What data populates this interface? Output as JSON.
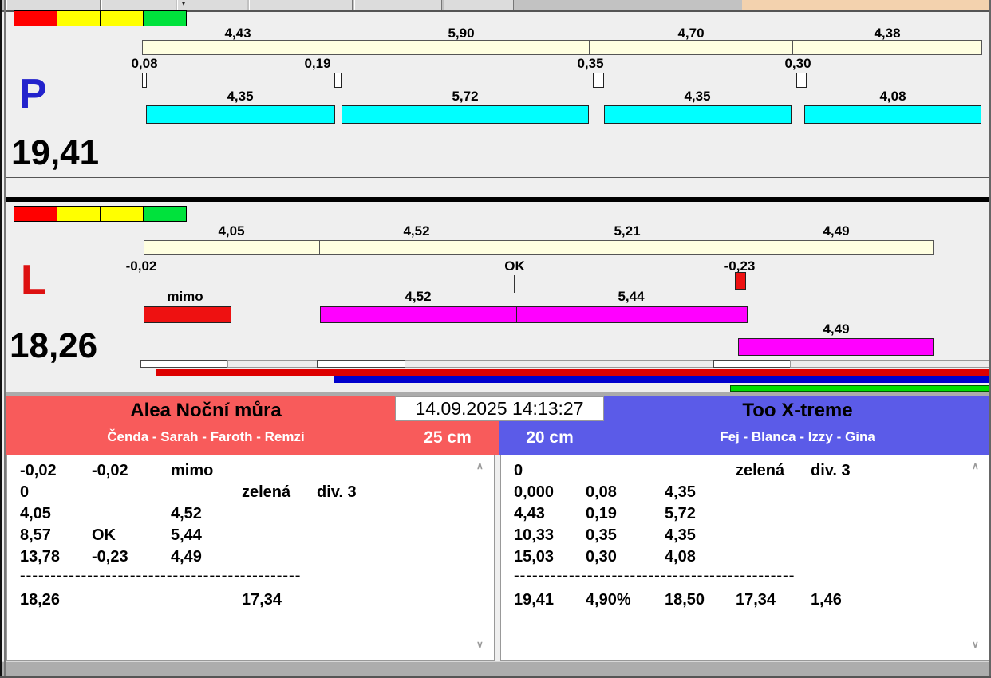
{
  "window": {
    "datetime": "14.09.2025 14:13:27"
  },
  "lane_p": {
    "letter": "P",
    "total": "19,41",
    "split_labels": [
      "4,43",
      "5,90",
      "4,70",
      "4,38"
    ],
    "start_offset_labels": [
      "0,08",
      "0,19",
      "0,35",
      "0,30"
    ],
    "run_labels": [
      "4,35",
      "5,72",
      "4,35",
      "4,08"
    ]
  },
  "lane_l": {
    "letter": "L",
    "total": "18,26",
    "split_labels": [
      "4,05",
      "4,52",
      "5,21",
      "4,49"
    ],
    "mark_labels": [
      "-0,02",
      "OK",
      "-0,23"
    ],
    "run_row1_labels": [
      "mimo",
      "4,52",
      "5,44"
    ],
    "run_row2_label": "4,49"
  },
  "left_team": {
    "name": "Alea Noční můra",
    "members": "Čenda - Sarah - Faroth - Remzi",
    "jump_height": "25 cm",
    "rows": [
      {
        "c0": "-0,02",
        "c1": "-0,02",
        "c2": "mimo"
      },
      {
        "c0": "0",
        "c3": "zelená",
        "c4": "div. 3"
      },
      {
        "c0": "4,05",
        "c2": "4,52"
      },
      {
        "c0": "8,57",
        "c1": "OK",
        "c2": "5,44"
      },
      {
        "c0": "13,78",
        "c1": "-0,23",
        "c2": "4,49"
      }
    ],
    "divider": "----------------------------------------------",
    "total_row": {
      "c0": "18,26",
      "c3": "17,34"
    }
  },
  "right_team": {
    "name": "Too X-treme",
    "members": "Fej - Blanca - Izzy - Gina",
    "jump_height": "20 cm",
    "rows": [
      {
        "c0": "0",
        "c3": "zelená",
        "c4": "div. 3"
      },
      {
        "c0": "0,000",
        "c1": "0,08",
        "c2": "4,35"
      },
      {
        "c0": "4,43",
        "c1": "0,19",
        "c2": "5,72"
      },
      {
        "c0": "10,33",
        "c1": "0,35",
        "c2": "4,35"
      },
      {
        "c0": "15,03",
        "c1": "0,30",
        "c2": "4,08"
      }
    ],
    "divider": "----------------------------------------------",
    "total_row": {
      "c0": "19,41",
      "c1": "4,90%",
      "c2": "18,50",
      "c3": "17,34",
      "c4": "1,46"
    }
  },
  "colors": {
    "team_left_red": "#f85b5b",
    "team_right_blue": "#5b5be8",
    "run_bar_cyan": "#00ffff",
    "run_bar_magenta": "#ff00ff",
    "fault_red": "#ee1111",
    "split_bar_cream": "#ffffe1",
    "legend_red": "#ff0000",
    "legend_yellow": "#ffff00",
    "legend_green": "#00e23c",
    "progress_red": "#dd0000",
    "progress_blue": "#0000cc",
    "progress_green": "#00dd00",
    "lane_p_letter": "#2222cc",
    "lane_l_letter": "#dd1111",
    "toolbar_tan": "#f3d2ae"
  }
}
